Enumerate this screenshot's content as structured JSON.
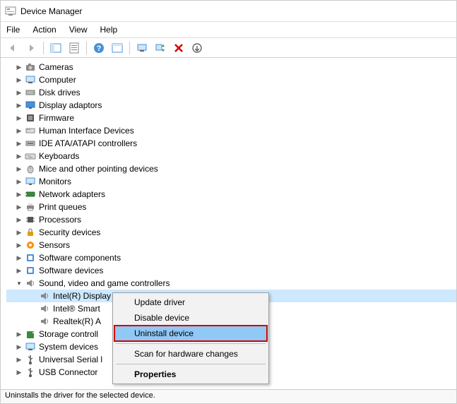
{
  "window": {
    "title": "Device Manager"
  },
  "menu": {
    "file": "File",
    "action": "Action",
    "view": "View",
    "help": "Help"
  },
  "toolbar": {
    "back": "back",
    "forward": "forward",
    "up": "up",
    "properties": "properties",
    "help": "help",
    "show": "show",
    "monitor": "monitor",
    "scan": "scan",
    "delete": "delete",
    "more": "more"
  },
  "tree": {
    "cameras": "Cameras",
    "computer": "Computer",
    "disk_drives": "Disk drives",
    "display_adaptors": "Display adaptors",
    "firmware": "Firmware",
    "hid": "Human Interface Devices",
    "ide": "IDE ATA/ATAPI controllers",
    "keyboards": "Keyboards",
    "mice": "Mice and other pointing devices",
    "monitors": "Monitors",
    "network": "Network adapters",
    "print_queues": "Print queues",
    "processors": "Processors",
    "security": "Security devices",
    "sensors": "Sensors",
    "software_components": "Software components",
    "software_devices": "Software devices",
    "sound": "Sound, video and game controllers",
    "sound_intel_display": "Intel(R) Display Audio",
    "sound_intel_smart": "Intel® Smart",
    "sound_realtek": "Realtek(R) A",
    "storage": "Storage controll",
    "system": "System devices",
    "usb_serial": "Universal Serial l",
    "usb_connector": "USB Connector"
  },
  "context_menu": {
    "update": "Update driver",
    "disable": "Disable device",
    "uninstall": "Uninstall device",
    "scan": "Scan for hardware changes",
    "properties": "Properties"
  },
  "statusbar": {
    "text": "Uninstalls the driver for the selected device."
  }
}
